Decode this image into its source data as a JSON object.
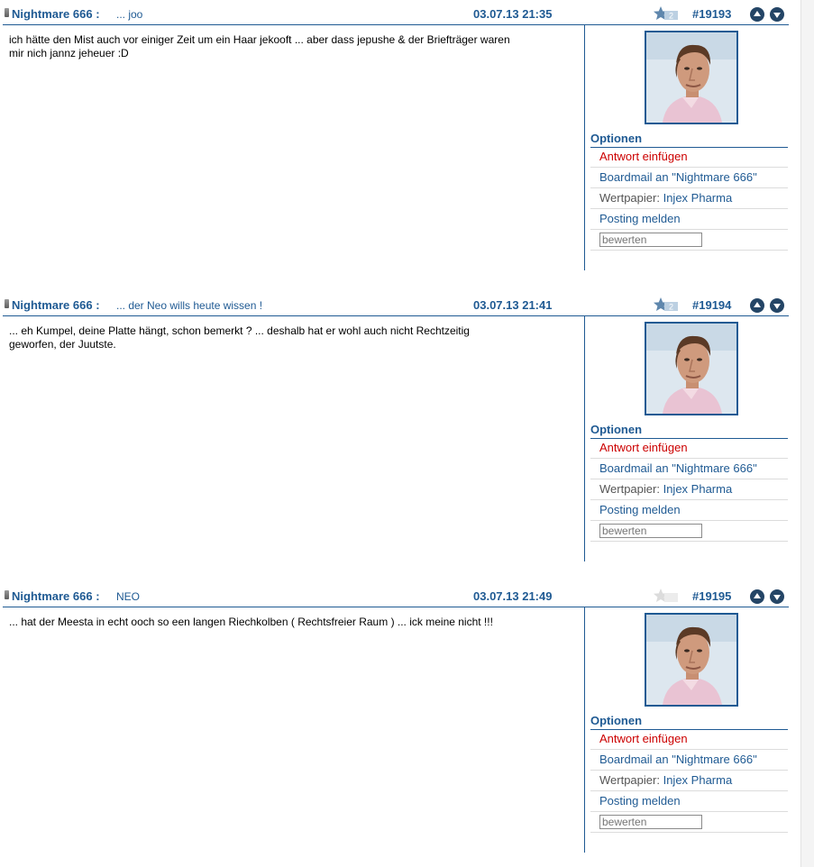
{
  "posts": [
    {
      "author": "Nightmare 666 :",
      "subject": "... joo",
      "date": "03.07.13 21:35",
      "star_count": "2",
      "number": "#19193",
      "body": "ich hätte den Mist auch vor einiger Zeit um ein Haar jekooft ... aber dass jepushe & der Briefträger waren mir nich jannz jeheuer :D"
    },
    {
      "author": "Nightmare 666 :",
      "subject": "... der Neo wills heute wissen !",
      "date": "03.07.13 21:41",
      "star_count": "2",
      "number": "#19194",
      "body": "... eh Kumpel, deine Platte hängt, schon bemerkt ? ... deshalb hat er wohl auch nicht Rechtzeitig geworfen, der Juutste."
    },
    {
      "author": "Nightmare 666 :",
      "subject": "NEO",
      "date": "03.07.13 21:49",
      "star_count": "",
      "number": "#19195",
      "body": "... hat der Meesta in echt ooch so een langen Riechkolben ( Rechtsfreier Raum ) ... ick meine nicht !!!"
    }
  ],
  "options": {
    "title": "Optionen",
    "reply": "Antwort einfügen",
    "boardmail": "Boardmail an \"Nightmare 666\"",
    "security_label": "Wertpapier:",
    "security_name": "Injex Pharma",
    "report": "Posting melden",
    "rate_placeholder": "bewerten"
  },
  "colors": {
    "link_blue": "#1f5a93",
    "reply_red": "#cc0000",
    "nav_button": "#244566"
  },
  "icons": [
    "post-marker-icon",
    "star-rating-icon",
    "arrow-up-icon",
    "arrow-down-icon"
  ]
}
